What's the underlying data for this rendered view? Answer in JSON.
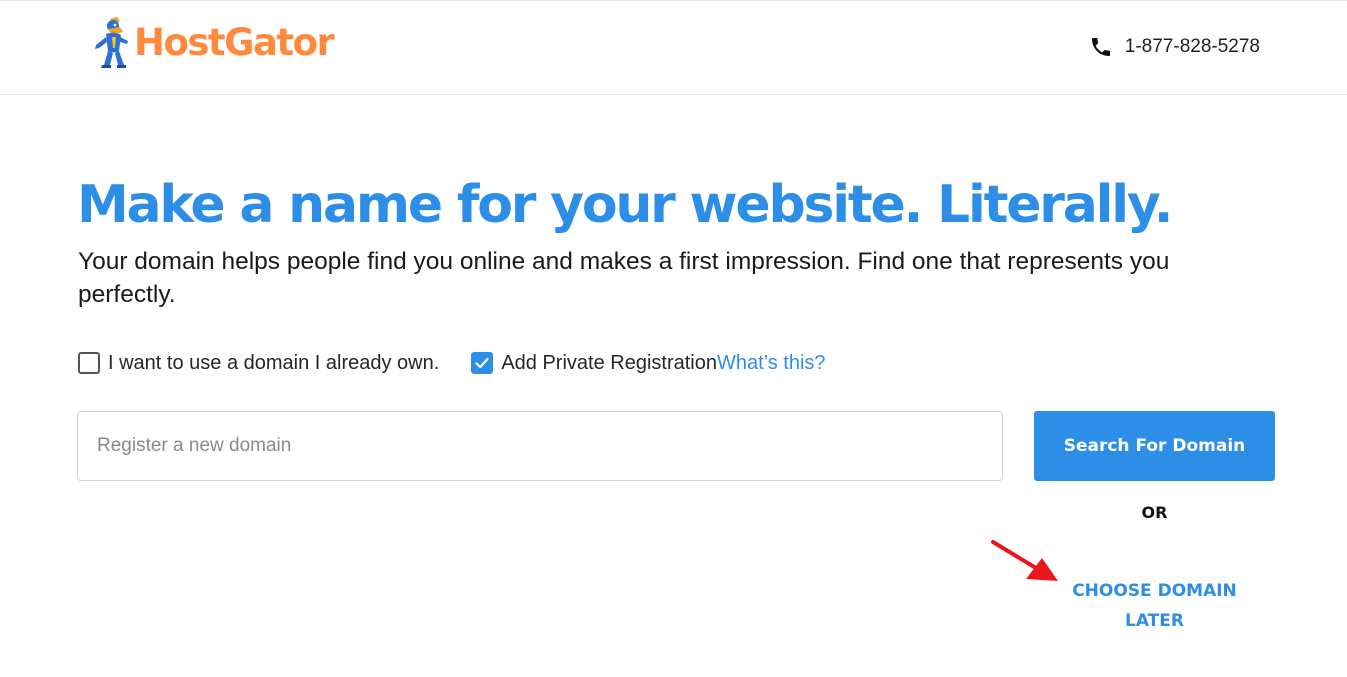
{
  "header": {
    "logo_text": "HostGator",
    "phone": "1-877-828-5278",
    "icons": {
      "mascot": "gator-mascot-icon",
      "phone": "phone-icon"
    }
  },
  "main": {
    "headline": "Make a name for your website. Literally.",
    "subhead": "Your domain helps people find you online and makes a first impression. Find one that represents you perfectly.",
    "options": {
      "own_domain": {
        "label": "I want to use a domain I already own.",
        "checked": false
      },
      "private_registration": {
        "label": "Add Private Registration",
        "checked": true,
        "link": "What’s this?"
      }
    },
    "search": {
      "placeholder": "Register a new domain",
      "value": "",
      "button_label": "Search For Domain"
    },
    "or_label": "OR",
    "choose_later": {
      "line1": "CHOOSE DOMAIN",
      "line2": "LATER"
    }
  },
  "colors": {
    "brand_orange": "#ff8a3d",
    "accent_blue": "#2d8ee8",
    "annotation_red": "#e8161b"
  }
}
